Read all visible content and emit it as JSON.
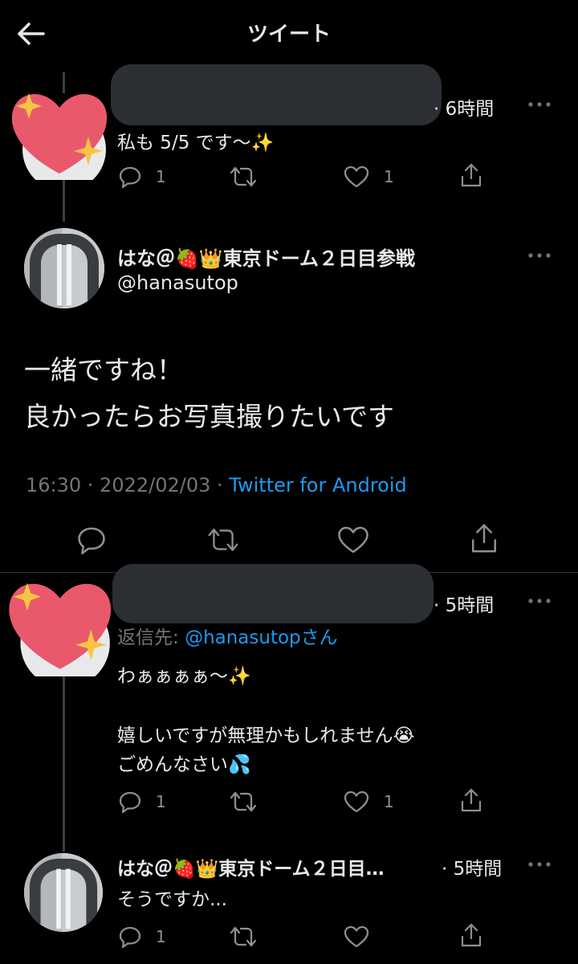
{
  "header": {
    "title": "ツイート"
  },
  "reply1": {
    "time": "· 6時間",
    "text": "私も 5/5 です〜✨",
    "reply_count": "1",
    "like_count": "1"
  },
  "main": {
    "name": "はな＠🍓👑東京ドーム２日目参戦",
    "handle": "@hanasutop",
    "line1": "一緒ですね！",
    "line2": "良かったらお写真撮りたいです",
    "time": "16:30 · 2022/02/03 · ",
    "client": "Twitter for Android"
  },
  "reply2": {
    "time": "· 5時間",
    "reply_to_label": "返信先: ",
    "reply_to_handle": "@hanasutop",
    "reply_to_suffix": "さん",
    "line1": "わぁぁぁぁ〜✨",
    "line2": "嬉しいですが無理かもしれません😭",
    "line3": "ごめんなさい💦",
    "reply_count": "1",
    "like_count": "1"
  },
  "reply3": {
    "name": "はな＠🍓👑東京ドーム２日目…",
    "time": "· 5時間",
    "text": "そうですか...",
    "reply_count": "1"
  },
  "colors": {
    "background": "#000000",
    "text": "#e7e9ea",
    "secondary": "#71767b",
    "accent": "#1d9bf0",
    "heart": "#e9596b",
    "sparkle": "#f5c542"
  }
}
